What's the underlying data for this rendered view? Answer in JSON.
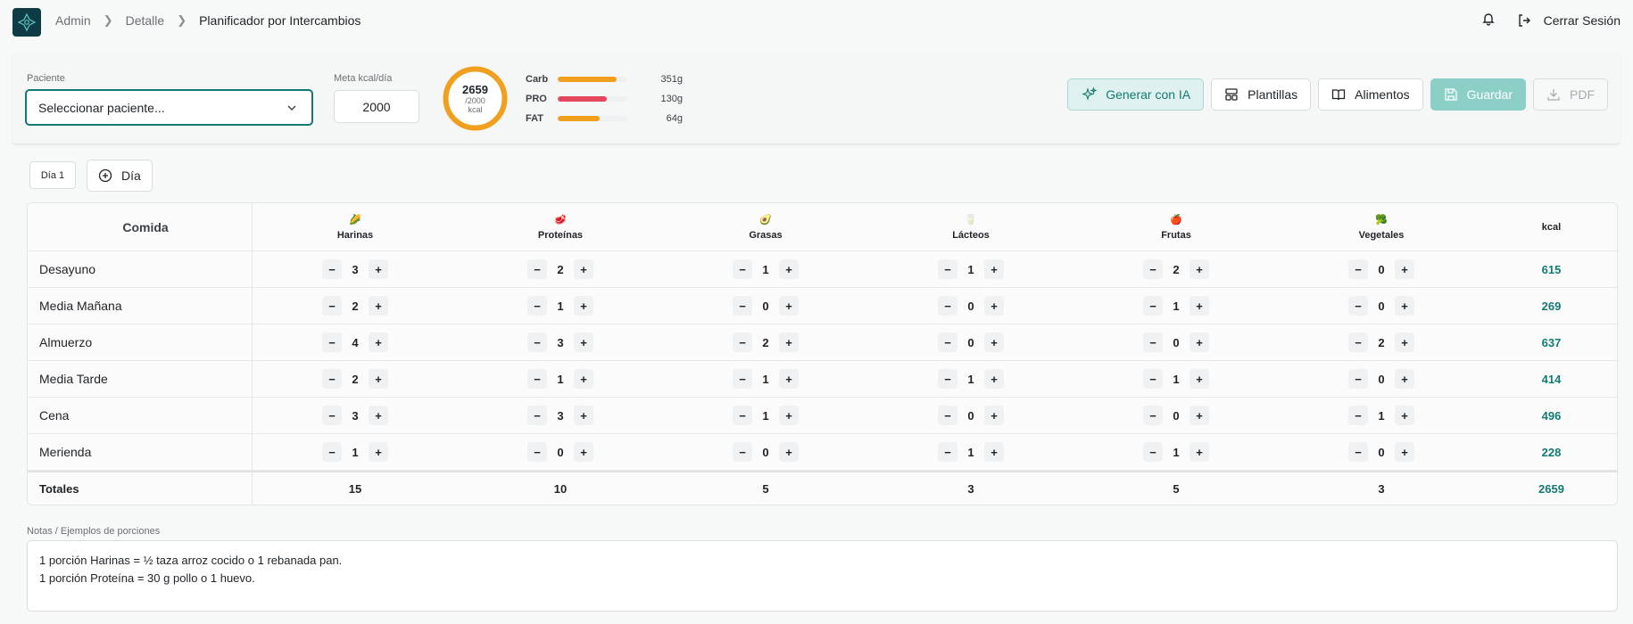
{
  "breadcrumb": {
    "items": [
      "Admin",
      "Detalle",
      "Planificador por Intercambios"
    ]
  },
  "header": {
    "logout_label": "Cerrar Sesión"
  },
  "panel": {
    "patient_label": "Paciente",
    "patient_select_value": "Seleccionar paciente...",
    "goal_label": "Meta kcal/día",
    "goal_value": "2000",
    "ring": {
      "value": "2659",
      "goal": "/2000",
      "unit": "kcal",
      "progress": 1.0
    },
    "macros": [
      {
        "name": "Carb",
        "value": "351g",
        "fill": 0.85,
        "color": "#f0a01e"
      },
      {
        "name": "PRO",
        "value": "130g",
        "fill": 0.7,
        "color": "#e4475c"
      },
      {
        "name": "FAT",
        "value": "64g",
        "fill": 0.6,
        "color": "#f0a01e"
      }
    ],
    "buttons": {
      "ai": "Generar con IA",
      "templates": "Plantillas",
      "foods": "Alimentos",
      "save": "Guardar",
      "pdf": "PDF"
    }
  },
  "days": {
    "tab_label": "Día 1",
    "add_label": "Día"
  },
  "table": {
    "first_header": "Comida",
    "columns": [
      {
        "label": "Harinas",
        "emoji": "🌽"
      },
      {
        "label": "Proteínas",
        "emoji": "🥩"
      },
      {
        "label": "Grasas",
        "emoji": "🥑"
      },
      {
        "label": "Lácteos",
        "emoji": "🥛"
      },
      {
        "label": "Frutas",
        "emoji": "🍎"
      },
      {
        "label": "Vegetales",
        "emoji": "🥦"
      }
    ],
    "kcal_header": "kcal",
    "minus": "−",
    "plus": "+",
    "rows": [
      {
        "meal": "Desayuno",
        "values": [
          "3",
          "2",
          "1",
          "1",
          "2",
          "0"
        ],
        "kcal": "615"
      },
      {
        "meal": "Media Mañana",
        "values": [
          "2",
          "1",
          "0",
          "0",
          "1",
          "0"
        ],
        "kcal": "269"
      },
      {
        "meal": "Almuerzo",
        "values": [
          "4",
          "3",
          "2",
          "0",
          "0",
          "2"
        ],
        "kcal": "637"
      },
      {
        "meal": "Media Tarde",
        "values": [
          "2",
          "1",
          "1",
          "1",
          "1",
          "0"
        ],
        "kcal": "414"
      },
      {
        "meal": "Cena",
        "values": [
          "3",
          "3",
          "1",
          "0",
          "0",
          "1"
        ],
        "kcal": "496"
      },
      {
        "meal": "Merienda",
        "values": [
          "1",
          "0",
          "0",
          "1",
          "1",
          "0"
        ],
        "kcal": "228"
      }
    ],
    "totals": {
      "label": "Totales",
      "values": [
        "15",
        "10",
        "5",
        "3",
        "5",
        "3"
      ],
      "kcal": "2659"
    }
  },
  "notes": {
    "label": "Notas / Ejemplos de porciones",
    "lines": [
      "1 porción Harinas = ½ taza arroz cocido o 1 rebanada pan.",
      "1 porción Proteína = 30 g pollo o 1 huevo."
    ]
  },
  "colors": {
    "primary": "#137a73",
    "logo_bg": "#0f3b44",
    "ring": "#f0a01e"
  }
}
